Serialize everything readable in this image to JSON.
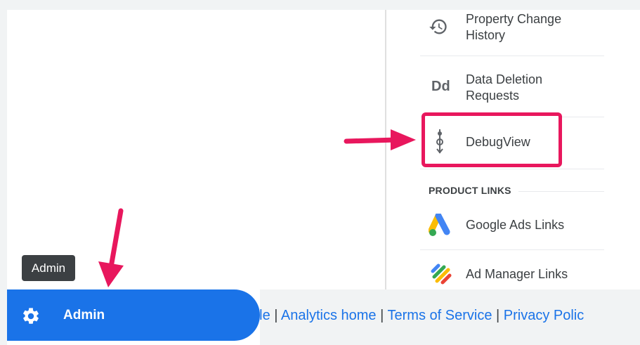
{
  "left_nav": {
    "tooltip": "Admin",
    "admin_button_label": "Admin",
    "admin_icon": "gear-icon",
    "active_color": "#1a73e8"
  },
  "menu": {
    "items": [
      {
        "label_line1": "Property Change",
        "label_line2": "History",
        "icon": "history-icon"
      },
      {
        "label_line1": "Data Deletion",
        "label_line2": "Requests",
        "icon": "dd-icon",
        "icon_text": "Dd"
      },
      {
        "label": "DebugView",
        "icon": "debug-icon",
        "highlighted": true
      }
    ],
    "section_title": "PRODUCT LINKS",
    "links": [
      {
        "label": "Google Ads Links",
        "icon": "google-ads-icon"
      },
      {
        "label": "Ad Manager Links",
        "icon": "ad-manager-icon"
      }
    ]
  },
  "footer": {
    "partial_google": "gle",
    "sep": "|",
    "analytics_home": "Analytics home",
    "terms": "Terms of Service",
    "privacy": "Privacy Polic"
  },
  "annotation": {
    "arrow_color": "#e8175d",
    "box_color": "#e8175d"
  }
}
